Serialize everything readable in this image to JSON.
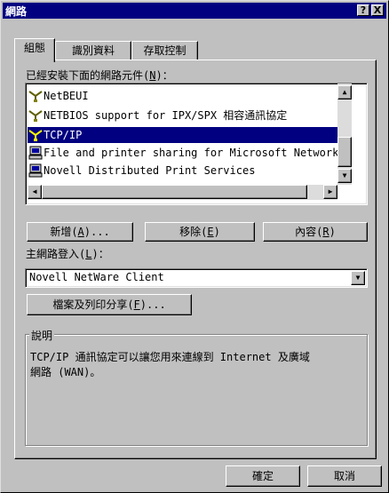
{
  "window": {
    "title": "網路",
    "help_label": "?",
    "close_label": "X"
  },
  "tabs": [
    {
      "label": "組態",
      "active": true
    },
    {
      "label": "識別資料",
      "active": false
    },
    {
      "label": "存取控制",
      "active": false
    }
  ],
  "components": {
    "label_prefix": "已經安裝下面的網路元件(",
    "label_key": "N",
    "label_suffix": ")：",
    "items": [
      {
        "label": "NetBEUI",
        "icon": "protocol-icon",
        "selected": false
      },
      {
        "label": "NETBIOS support for IPX/SPX 相容通訊協定",
        "icon": "protocol-icon",
        "selected": false
      },
      {
        "label": "TCP/IP",
        "icon": "protocol-icon",
        "selected": true
      },
      {
        "label": "File and printer sharing for Microsoft Networks",
        "icon": "service-icon",
        "selected": false
      },
      {
        "label": "Novell Distributed Print Services",
        "icon": "service-icon",
        "selected": false
      }
    ]
  },
  "buttons": {
    "add_prefix": "新增(",
    "add_key": "A",
    "add_suffix": ")...",
    "remove_prefix": "移除(",
    "remove_key": "E",
    "remove_suffix": ")",
    "properties_prefix": "內容(",
    "properties_key": "R",
    "properties_suffix": ")",
    "file_print_prefix": "檔案及列印分享(",
    "file_print_key": "F",
    "file_print_suffix": ")...",
    "ok": "確定",
    "cancel": "取消"
  },
  "logon": {
    "label_prefix": "主網路登入(",
    "label_key": "L",
    "label_suffix": ")：",
    "selected": "Novell NetWare Client"
  },
  "description": {
    "title": "說明",
    "text_line1": "TCP/IP 通訊協定可以讓您用來連線到 Internet 及廣域",
    "text_line2": "網路 (WAN)。"
  }
}
